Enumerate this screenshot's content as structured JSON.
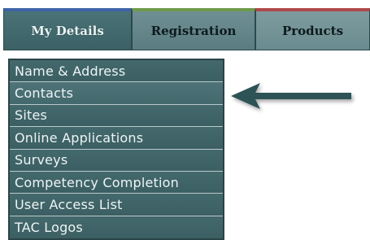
{
  "tabs": {
    "my_details": "My Details",
    "registration": "Registration",
    "products": "Products"
  },
  "menu": {
    "items": [
      "Name & Address",
      "Contacts",
      "Sites",
      "Online Applications",
      "Surveys",
      "Competency Completion",
      "User Access List",
      "TAC Logos"
    ]
  },
  "colors": {
    "menu_bg": "#3f6468",
    "arrow": "#2f5257",
    "tab_accent_blue": "#3d63a6",
    "tab_accent_green": "#6e9a4c",
    "tab_accent_red": "#b0484a"
  }
}
